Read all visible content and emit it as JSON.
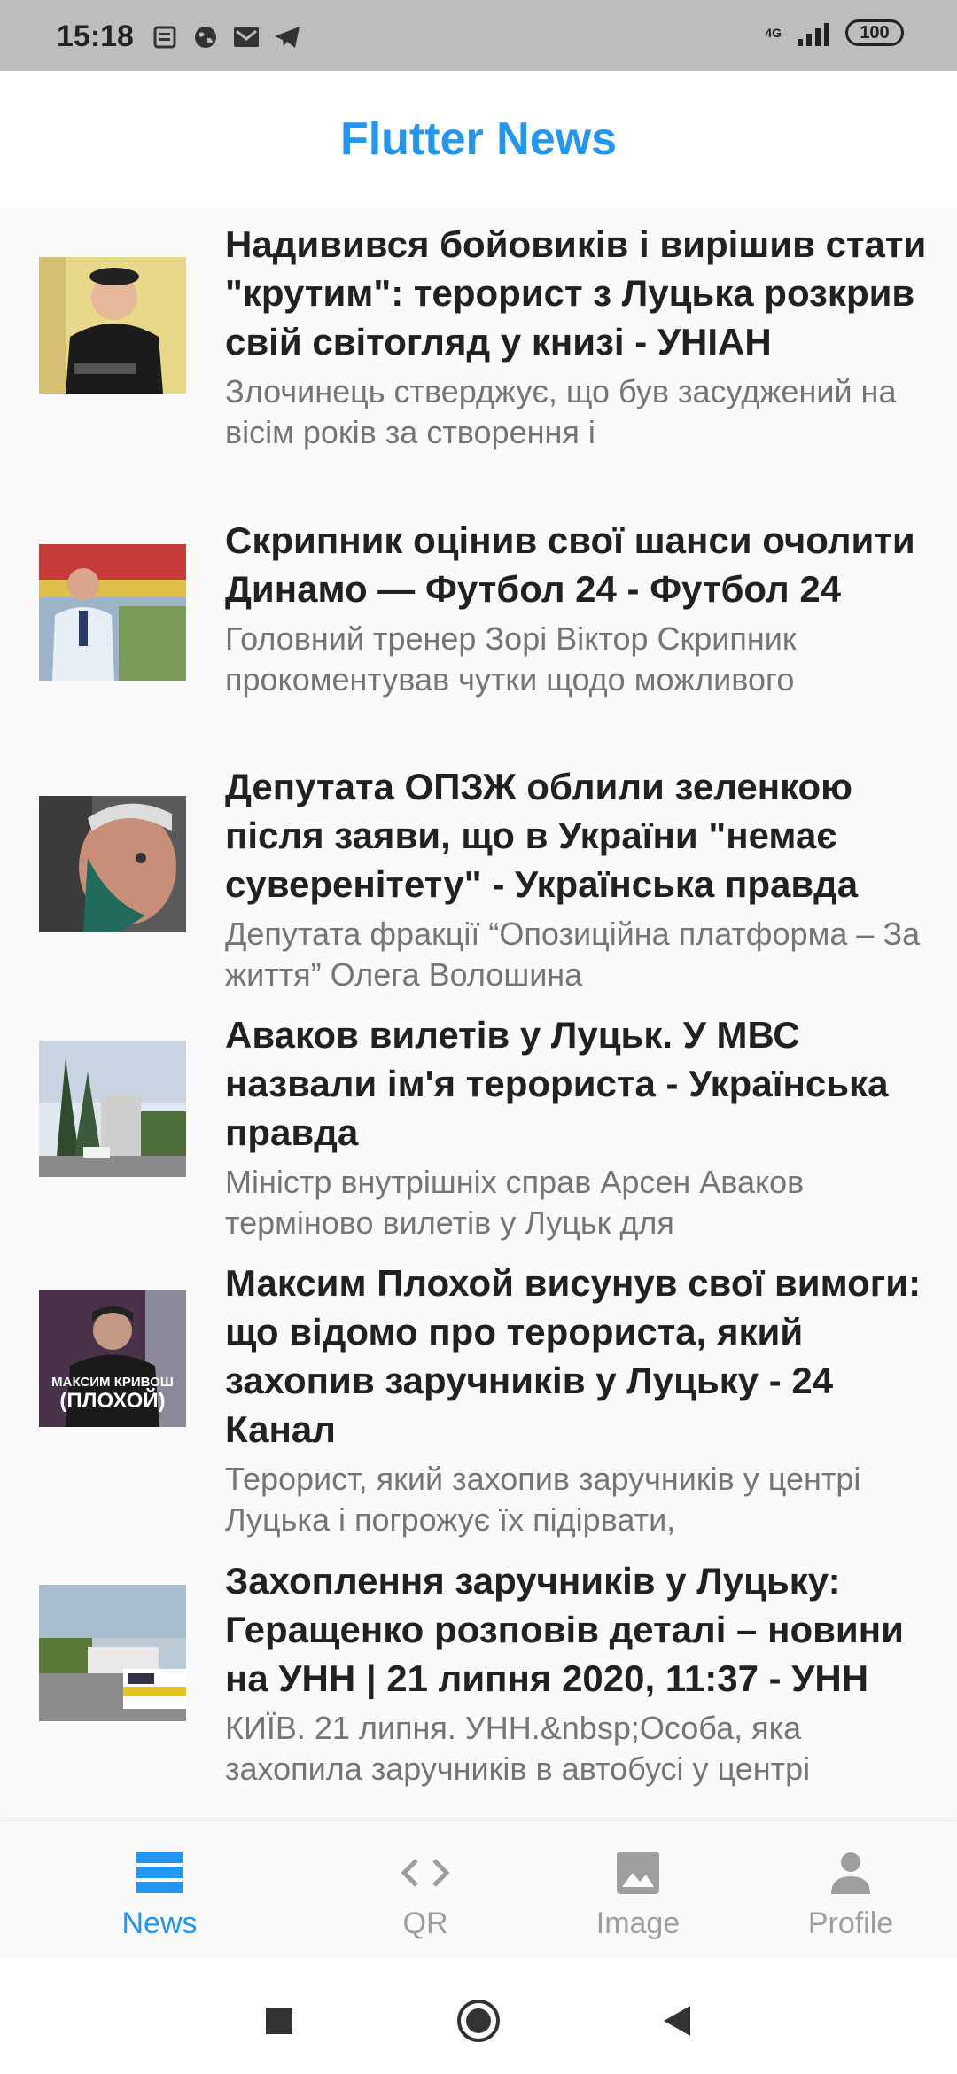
{
  "status_bar": {
    "time": "15:18",
    "network": "4G",
    "battery": "100",
    "icons": [
      "news-app-icon",
      "globe-icon",
      "mail-icon",
      "telegram-icon"
    ]
  },
  "app": {
    "title": "Flutter News",
    "accent": "#2196f3"
  },
  "articles": [
    {
      "title": "Надивився бойовиків і вирішив стати \"крутим\": терорист з Луцька розкрив свій світогляд у книзі - УНІАН",
      "description": "Злочинець стверджує, що був засуджений на вісім років за створення і"
    },
    {
      "title": "Скрипник оцінив свої шанси очолити Динамо — Футбол 24 - Футбол 24",
      "description": "Головний тренер Зорі Віктор Скрипник прокоментував чутки щодо можливого"
    },
    {
      "title": "Депутата ОПЗЖ облили зеленкою після заяви, що в України \"немає суверенітету\" - Українська правда",
      "description": "Депутата фракції “Опозиційна платформа – За життя” Олега Волошина"
    },
    {
      "title": "Аваков вилетів у Луцьк. У МВС назвали ім'я терориста - Українська правда",
      "description": "Міністр внутрішніх справ Арсен Аваков терміново вилетів у Луцьк для"
    },
    {
      "title": "Максим Плохой висунув свої вимоги: що відомо про терориста, який захопив заручників у Луцьку - 24 Канал",
      "description": "Терорист, який захопив заручників у центрі Луцька і погрожує їх підірвати,",
      "thumb_caption_1": "МАКСИМ КРИВОШ",
      "thumb_caption_2": "(ПЛОХОЙ)"
    },
    {
      "title": "Захоплення заручників у Луцьку: Геращенко розповів деталі – новини на УНН | 21 липня 2020, 11:37 - УНН",
      "description": "КИЇВ. 21 липня. УНН.&nbsp;Особа, яка захопила заручників в автобусі у центрі"
    }
  ],
  "bottom_nav": {
    "active_color": "#2196f3",
    "inactive_color": "#9e9e9e",
    "tabs": [
      {
        "label": "News",
        "icon": "news-icon",
        "active": true
      },
      {
        "label": "QR",
        "icon": "code-icon",
        "active": false
      },
      {
        "label": "Image",
        "icon": "image-icon",
        "active": false
      },
      {
        "label": "Profile",
        "icon": "person-icon",
        "active": false
      }
    ]
  },
  "system_nav": [
    "recents-square-icon",
    "home-circle-icon",
    "back-triangle-icon"
  ]
}
